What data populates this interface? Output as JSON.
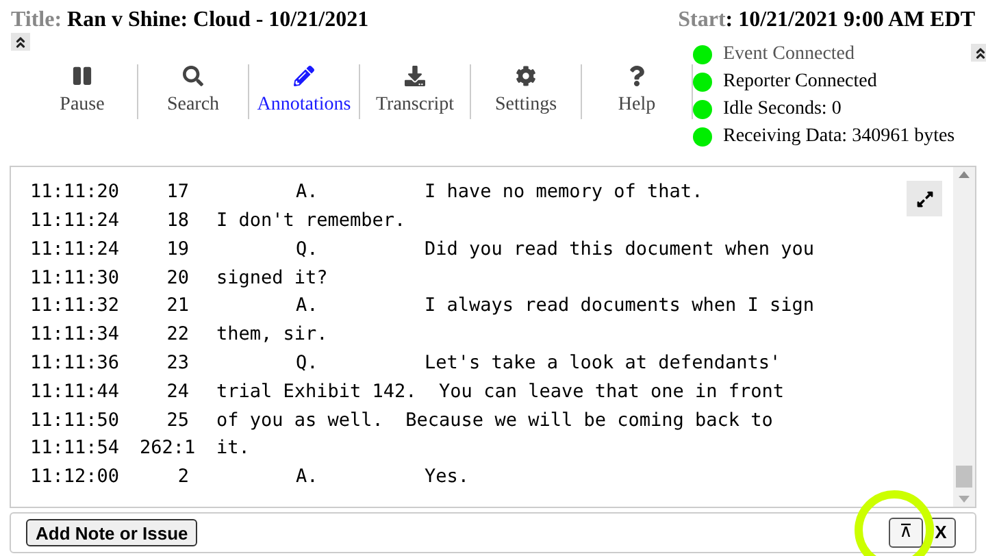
{
  "header": {
    "title_label": "Title:",
    "title": "Ran v Shine: Cloud - 10/21/2021",
    "start_label": "Start",
    "start": ": 10/21/2021 9:00 AM EDT"
  },
  "toolbar": [
    {
      "label": "Pause",
      "kind": "pause",
      "selected": false
    },
    {
      "label": "Search",
      "kind": "search",
      "selected": false
    },
    {
      "label": "Annotations",
      "kind": "pencil",
      "selected": true
    },
    {
      "label": "Transcript",
      "kind": "download",
      "selected": false
    },
    {
      "label": "Settings",
      "kind": "gear",
      "selected": false
    },
    {
      "label": "Help",
      "kind": "help",
      "selected": false
    }
  ],
  "status": [
    {
      "text": "Event Connected",
      "on": true
    },
    {
      "text": "Reporter Connected",
      "on": true
    },
    {
      "text": "Idle Seconds: 0",
      "on": true
    },
    {
      "text": "Receiving Data: 340961 bytes",
      "on": true
    }
  ],
  "transcript": [
    {
      "time": "11:11:20",
      "line": "17",
      "kind": "speaker",
      "speaker": "A.",
      "text": "I have no memory of that."
    },
    {
      "time": "11:11:24",
      "line": "18",
      "kind": "cont",
      "text": "I don't remember."
    },
    {
      "time": "11:11:24",
      "line": "19",
      "kind": "speaker",
      "speaker": "Q.",
      "text": "Did you read this document when you"
    },
    {
      "time": "11:11:30",
      "line": "20",
      "kind": "cont",
      "text": "signed it?"
    },
    {
      "time": "11:11:32",
      "line": "21",
      "kind": "speaker",
      "speaker": "A.",
      "text": "I always read documents when I sign"
    },
    {
      "time": "11:11:34",
      "line": "22",
      "kind": "cont",
      "text": "them, sir."
    },
    {
      "time": "11:11:36",
      "line": "23",
      "kind": "speaker",
      "speaker": "Q.",
      "text": "Let's take a look at defendants'"
    },
    {
      "time": "11:11:44",
      "line": "24",
      "kind": "cont",
      "text": "trial Exhibit 142.  You can leave that one in front"
    },
    {
      "time": "11:11:50",
      "line": "25",
      "kind": "cont",
      "text": "of you as well.  Because we will be coming back to"
    },
    {
      "time": "11:11:54",
      "line": "262:1",
      "kind": "cont",
      "text": "it."
    },
    {
      "time": "11:12:00",
      "line": "2",
      "kind": "speaker",
      "speaker": "A.",
      "text": "Yes."
    }
  ],
  "footer": {
    "add_button": "Add Note or Issue",
    "top_button": "⊼",
    "close_button": "X",
    "highlighted": true
  }
}
